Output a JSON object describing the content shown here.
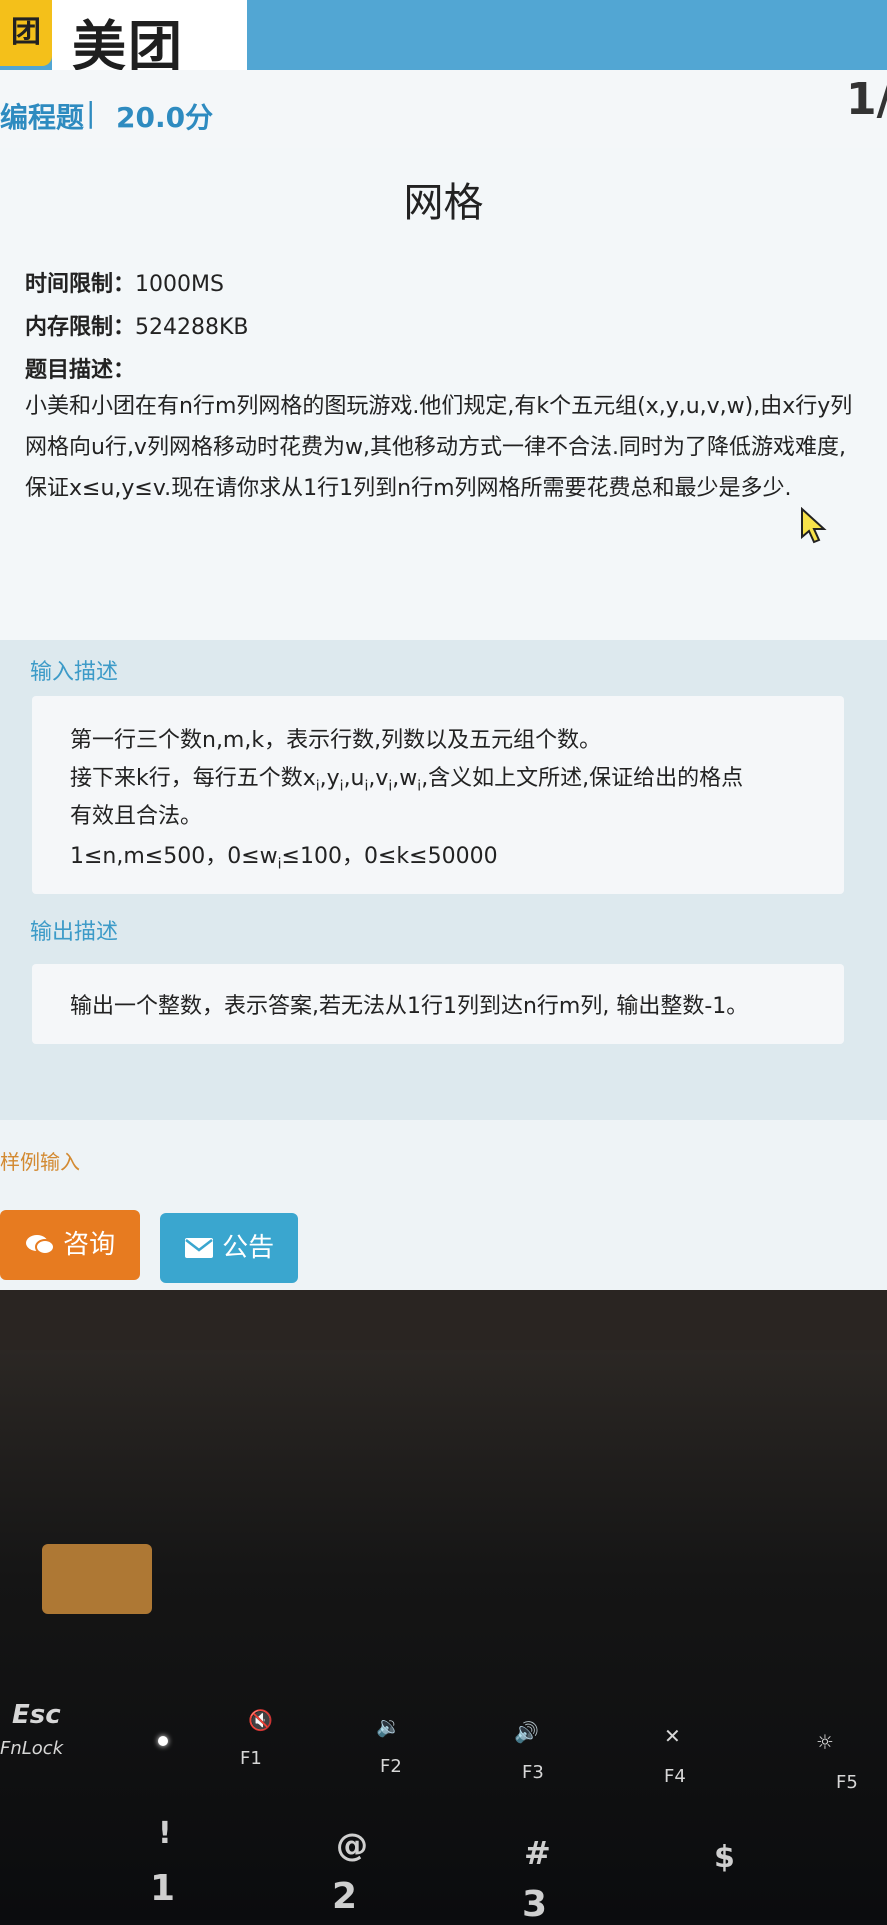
{
  "header": {
    "brand_badge": "团",
    "brand": "美团",
    "question_type": "编程题",
    "separator": "|",
    "score": "20.0分",
    "page_indicator": "1/"
  },
  "problem": {
    "title": "网格",
    "time_limit_label": "时间限制：",
    "time_limit": "1000MS",
    "memory_limit_label": "内存限制：",
    "memory_limit": "524288KB",
    "description_label": "题目描述：",
    "description": "小美和小团在有n行m列网格的图玩游戏.他们规定,有k个五元组(x,y,u,v,w),由x行y列网格向u行,v列网格移动时花费为w,其他移动方式一律不合法.同时为了降低游戏难度,保证x≤u,y≤v.现在请你求从1行1列到n行m列网格所需要花费总和最少是多少."
  },
  "input_section": {
    "label": "输入描述",
    "line1": "第一行三个数n,m,k，表示行数,列数以及五元组个数。",
    "line2_prefix": "接下来k行，每行五个数x",
    "line2_y": ",y",
    "line2_u": ",u",
    "line2_v": ",v",
    "line2_w": ",w",
    "sub_i": "i",
    "line2_suffix": ",含义如上文所述,保证给出的格点",
    "line3": "有效且合法。",
    "line4_a": "1≤n,m≤500，0≤w",
    "line4_b": "≤100，0≤k≤50000"
  },
  "output_section": {
    "label": "输出描述",
    "text": "输出一个整数，表示答案,若无法从1行1列到达n行m列, 输出整数-1。"
  },
  "sample_label": "样例输入",
  "buttons": {
    "consult": "咨询",
    "notice": "公告"
  },
  "keyboard": {
    "esc": "Esc",
    "fnlock": "FnLock",
    "f1": "F1",
    "f2": "F2",
    "f3": "F3",
    "f4": "F4",
    "f5": "F5",
    "sym_excl": "!",
    "sym_at": "@",
    "sym_hash": "#",
    "sym_dollar": "$",
    "num1": "1",
    "num2": "2",
    "num3": "3"
  }
}
